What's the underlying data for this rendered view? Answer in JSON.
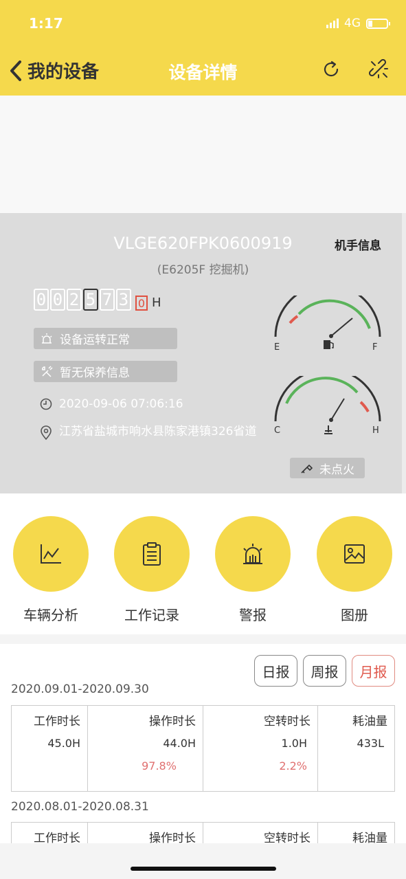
{
  "status_bar": {
    "time": "1:17",
    "network": "4G"
  },
  "nav": {
    "back_label": "我的设备",
    "title": "设备详情",
    "refresh_icon": "refresh-icon",
    "unlink_icon": "unlink-icon"
  },
  "device": {
    "vin": "VLGE620FPK0600919",
    "model": "(E6205F 挖掘机)",
    "operator_link": "机手信息",
    "odometer_digits": [
      "0",
      "0",
      "2",
      "5",
      "7",
      "3"
    ],
    "odometer_decimal": "0",
    "odometer_unit": "H",
    "status_text": "设备运转正常",
    "maintenance_text": "暂无保养信息",
    "timestamp": "2020-09-06 07:06:16",
    "location": "江苏省盐城市响水县陈家港镇326省道",
    "fuel_gauge": {
      "low_label": "E",
      "high_label": "F",
      "level": 0.75
    },
    "temp_gauge": {
      "low_label": "C",
      "high_label": "H",
      "level": 0.6
    },
    "ignition_text": "未点火"
  },
  "menu": [
    {
      "label": "车辆分析",
      "icon": "line-chart-icon"
    },
    {
      "label": "工作记录",
      "icon": "clipboard-icon"
    },
    {
      "label": "警报",
      "icon": "alarm-icon"
    },
    {
      "label": "图册",
      "icon": "image-icon"
    }
  ],
  "report": {
    "periods": [
      "日报",
      "周报",
      "月报"
    ],
    "active_period": "月报",
    "entries": [
      {
        "range": "2020.09.01-2020.09.30",
        "work_hours_label": "工作时长",
        "work_hours": "45.0H",
        "op_hours_label": "操作时长",
        "op_hours": "44.0H",
        "op_pct": "97.8%",
        "idle_hours_label": "空转时长",
        "idle_hours": "1.0H",
        "idle_pct": "2.2%",
        "fuel_label": "耗油量",
        "fuel": "433L"
      },
      {
        "range": "2020.08.01-2020.08.31",
        "work_hours_label": "工作时长",
        "op_hours_label": "操作时长",
        "idle_hours_label": "空转时长",
        "fuel_label": "耗油量"
      }
    ]
  },
  "colors": {
    "brand": "#f5d94c",
    "alert": "#e05a4e",
    "gauge_green": "#5ab35a"
  }
}
